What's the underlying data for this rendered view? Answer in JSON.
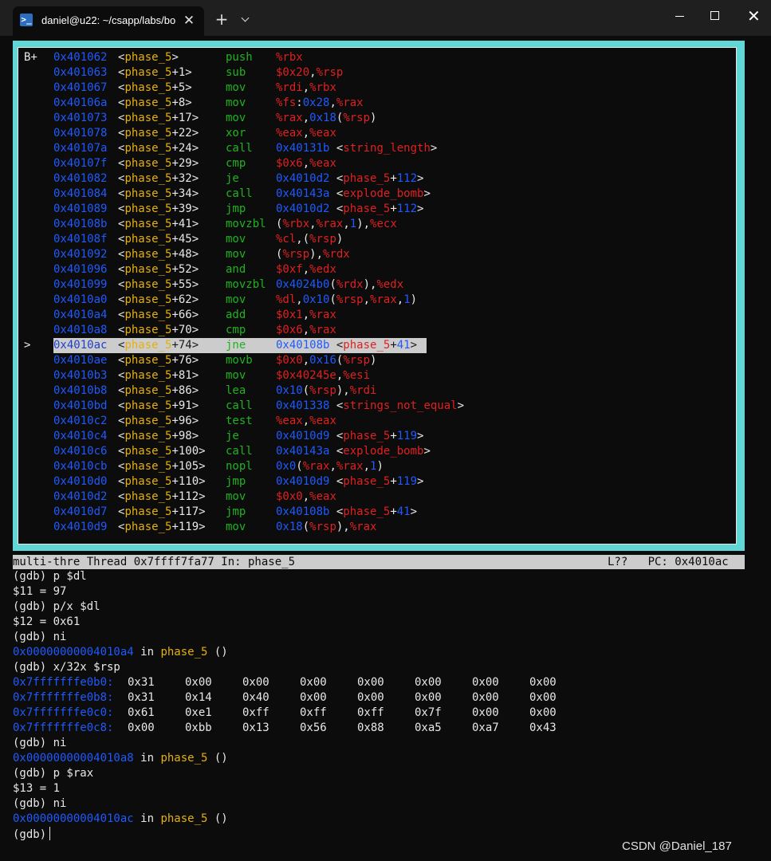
{
  "window": {
    "tab_icon": "terminal-prompt-icon",
    "tab_icon_glyph": ">_",
    "tab_title": "daniel@u22: ~/csapp/labs/bo",
    "close_glyph": "✕",
    "new_tab_glyph": "+"
  },
  "colors": {
    "tui_border": "#61d6d6",
    "address": "#1f5aff",
    "function_name": "#e5b00c",
    "mnemonic": "#1fb31f",
    "register": "#e02020",
    "highlight": "#cccccc"
  },
  "asm": [
    {
      "mark": "B+",
      "addr": "0x401062",
      "sym": "<phase_5>",
      "mn": "push",
      "op": [
        [
          "reg",
          "%rbx"
        ]
      ]
    },
    {
      "mark": "",
      "addr": "0x401063",
      "sym": "<phase_5+1>",
      "mn": "sub",
      "op": [
        [
          "reg",
          "$0x20"
        ],
        [
          "pun",
          ","
        ],
        [
          "reg",
          "%rsp"
        ]
      ]
    },
    {
      "mark": "",
      "addr": "0x401067",
      "sym": "<phase_5+5>",
      "mn": "mov",
      "op": [
        [
          "reg",
          "%rdi"
        ],
        [
          "pun",
          ","
        ],
        [
          "reg",
          "%rbx"
        ]
      ]
    },
    {
      "mark": "",
      "addr": "0x40106a",
      "sym": "<phase_5+8>",
      "mn": "mov",
      "op": [
        [
          "reg",
          "%fs"
        ],
        [
          "pun",
          ":"
        ],
        [
          "num",
          "0x28"
        ],
        [
          "pun",
          ","
        ],
        [
          "reg",
          "%rax"
        ]
      ]
    },
    {
      "mark": "",
      "addr": "0x401073",
      "sym": "<phase_5+17>",
      "mn": "mov",
      "op": [
        [
          "reg",
          "%rax"
        ],
        [
          "pun",
          ","
        ],
        [
          "num",
          "0x18"
        ],
        [
          "pun",
          "("
        ],
        [
          "reg",
          "%rsp"
        ],
        [
          "pun",
          ")"
        ]
      ]
    },
    {
      "mark": "",
      "addr": "0x401078",
      "sym": "<phase_5+22>",
      "mn": "xor",
      "op": [
        [
          "reg",
          "%eax"
        ],
        [
          "pun",
          ","
        ],
        [
          "reg",
          "%eax"
        ]
      ]
    },
    {
      "mark": "",
      "addr": "0x40107a",
      "sym": "<phase_5+24>",
      "mn": "call",
      "op": [
        [
          "num",
          "0x40131b"
        ],
        [
          "pun",
          " <"
        ],
        [
          "sym",
          "string_length"
        ],
        [
          "pun",
          ">"
        ]
      ]
    },
    {
      "mark": "",
      "addr": "0x40107f",
      "sym": "<phase_5+29>",
      "mn": "cmp",
      "op": [
        [
          "reg",
          "$0x6"
        ],
        [
          "pun",
          ","
        ],
        [
          "reg",
          "%eax"
        ]
      ]
    },
    {
      "mark": "",
      "addr": "0x401082",
      "sym": "<phase_5+32>",
      "mn": "je",
      "op": [
        [
          "num",
          "0x4010d2"
        ],
        [
          "pun",
          " <"
        ],
        [
          "sym",
          "phase_5"
        ],
        [
          "pun",
          "+"
        ],
        [
          "num",
          "112"
        ],
        [
          "pun",
          ">"
        ]
      ]
    },
    {
      "mark": "",
      "addr": "0x401084",
      "sym": "<phase_5+34>",
      "mn": "call",
      "op": [
        [
          "num",
          "0x40143a"
        ],
        [
          "pun",
          " <"
        ],
        [
          "sym",
          "explode_bomb"
        ],
        [
          "pun",
          ">"
        ]
      ]
    },
    {
      "mark": "",
      "addr": "0x401089",
      "sym": "<phase_5+39>",
      "mn": "jmp",
      "op": [
        [
          "num",
          "0x4010d2"
        ],
        [
          "pun",
          " <"
        ],
        [
          "sym",
          "phase_5"
        ],
        [
          "pun",
          "+"
        ],
        [
          "num",
          "112"
        ],
        [
          "pun",
          ">"
        ]
      ]
    },
    {
      "mark": "",
      "addr": "0x40108b",
      "sym": "<phase_5+41>",
      "mn": "movzbl",
      "op": [
        [
          "pun",
          "("
        ],
        [
          "reg",
          "%rbx"
        ],
        [
          "pun",
          ","
        ],
        [
          "reg",
          "%rax"
        ],
        [
          "pun",
          ","
        ],
        [
          "num",
          "1"
        ],
        [
          "pun",
          "),"
        ],
        [
          "reg",
          "%ecx"
        ]
      ]
    },
    {
      "mark": "",
      "addr": "0x40108f",
      "sym": "<phase_5+45>",
      "mn": "mov",
      "op": [
        [
          "reg",
          "%cl"
        ],
        [
          "pun",
          ",("
        ],
        [
          "reg",
          "%rsp"
        ],
        [
          "pun",
          ")"
        ]
      ]
    },
    {
      "mark": "",
      "addr": "0x401092",
      "sym": "<phase_5+48>",
      "mn": "mov",
      "op": [
        [
          "pun",
          "("
        ],
        [
          "reg",
          "%rsp"
        ],
        [
          "pun",
          "),"
        ],
        [
          "reg",
          "%rdx"
        ]
      ]
    },
    {
      "mark": "",
      "addr": "0x401096",
      "sym": "<phase_5+52>",
      "mn": "and",
      "op": [
        [
          "reg",
          "$0xf"
        ],
        [
          "pun",
          ","
        ],
        [
          "reg",
          "%edx"
        ]
      ]
    },
    {
      "mark": "",
      "addr": "0x401099",
      "sym": "<phase_5+55>",
      "mn": "movzbl",
      "op": [
        [
          "num",
          "0x4024b0"
        ],
        [
          "pun",
          "("
        ],
        [
          "reg",
          "%rdx"
        ],
        [
          "pun",
          "),"
        ],
        [
          "reg",
          "%edx"
        ]
      ]
    },
    {
      "mark": "",
      "addr": "0x4010a0",
      "sym": "<phase_5+62>",
      "mn": "mov",
      "op": [
        [
          "reg",
          "%dl"
        ],
        [
          "pun",
          ","
        ],
        [
          "num",
          "0x10"
        ],
        [
          "pun",
          "("
        ],
        [
          "reg",
          "%rsp"
        ],
        [
          "pun",
          ","
        ],
        [
          "reg",
          "%rax"
        ],
        [
          "pun",
          ","
        ],
        [
          "num",
          "1"
        ],
        [
          "pun",
          ")"
        ]
      ]
    },
    {
      "mark": "",
      "addr": "0x4010a4",
      "sym": "<phase_5+66>",
      "mn": "add",
      "op": [
        [
          "reg",
          "$0x1"
        ],
        [
          "pun",
          ","
        ],
        [
          "reg",
          "%rax"
        ]
      ]
    },
    {
      "mark": "",
      "addr": "0x4010a8",
      "sym": "<phase_5+70>",
      "mn": "cmp",
      "op": [
        [
          "reg",
          "$0x6"
        ],
        [
          "pun",
          ","
        ],
        [
          "reg",
          "%rax"
        ]
      ]
    },
    {
      "mark": ">",
      "addr": "0x4010ac",
      "sym": "<phase_5+74>",
      "mn": "jne",
      "current": true,
      "op": [
        [
          "num",
          "0x40108b"
        ],
        [
          "pun",
          " <"
        ],
        [
          "sym",
          "phase_5"
        ],
        [
          "pun",
          "+"
        ],
        [
          "num",
          "41"
        ],
        [
          "pun",
          ">"
        ]
      ]
    },
    {
      "mark": "",
      "addr": "0x4010ae",
      "sym": "<phase_5+76>",
      "mn": "movb",
      "op": [
        [
          "reg",
          "$0x0"
        ],
        [
          "pun",
          ","
        ],
        [
          "num",
          "0x16"
        ],
        [
          "pun",
          "("
        ],
        [
          "reg",
          "%rsp"
        ],
        [
          "pun",
          ")"
        ]
      ]
    },
    {
      "mark": "",
      "addr": "0x4010b3",
      "sym": "<phase_5+81>",
      "mn": "mov",
      "op": [
        [
          "reg",
          "$0x40245e"
        ],
        [
          "pun",
          ","
        ],
        [
          "reg",
          "%esi"
        ]
      ]
    },
    {
      "mark": "",
      "addr": "0x4010b8",
      "sym": "<phase_5+86>",
      "mn": "lea",
      "op": [
        [
          "num",
          "0x10"
        ],
        [
          "pun",
          "("
        ],
        [
          "reg",
          "%rsp"
        ],
        [
          "pun",
          "),"
        ],
        [
          "reg",
          "%rdi"
        ]
      ]
    },
    {
      "mark": "",
      "addr": "0x4010bd",
      "sym": "<phase_5+91>",
      "mn": "call",
      "op": [
        [
          "num",
          "0x401338"
        ],
        [
          "pun",
          " <"
        ],
        [
          "sym",
          "strings_not_equal"
        ],
        [
          "pun",
          ">"
        ]
      ]
    },
    {
      "mark": "",
      "addr": "0x4010c2",
      "sym": "<phase_5+96>",
      "mn": "test",
      "op": [
        [
          "reg",
          "%eax"
        ],
        [
          "pun",
          ","
        ],
        [
          "reg",
          "%eax"
        ]
      ]
    },
    {
      "mark": "",
      "addr": "0x4010c4",
      "sym": "<phase_5+98>",
      "mn": "je",
      "op": [
        [
          "num",
          "0x4010d9"
        ],
        [
          "pun",
          " <"
        ],
        [
          "sym",
          "phase_5"
        ],
        [
          "pun",
          "+"
        ],
        [
          "num",
          "119"
        ],
        [
          "pun",
          ">"
        ]
      ]
    },
    {
      "mark": "",
      "addr": "0x4010c6",
      "sym": "<phase_5+100>",
      "mn": "call",
      "op": [
        [
          "num",
          "0x40143a"
        ],
        [
          "pun",
          " <"
        ],
        [
          "sym",
          "explode_bomb"
        ],
        [
          "pun",
          ">"
        ]
      ]
    },
    {
      "mark": "",
      "addr": "0x4010cb",
      "sym": "<phase_5+105>",
      "mn": "nopl",
      "op": [
        [
          "num",
          "0x0"
        ],
        [
          "pun",
          "("
        ],
        [
          "reg",
          "%rax"
        ],
        [
          "pun",
          ","
        ],
        [
          "reg",
          "%rax"
        ],
        [
          "pun",
          ","
        ],
        [
          "num",
          "1"
        ],
        [
          "pun",
          ")"
        ]
      ]
    },
    {
      "mark": "",
      "addr": "0x4010d0",
      "sym": "<phase_5+110>",
      "mn": "jmp",
      "op": [
        [
          "num",
          "0x4010d9"
        ],
        [
          "pun",
          " <"
        ],
        [
          "sym",
          "phase_5"
        ],
        [
          "pun",
          "+"
        ],
        [
          "num",
          "119"
        ],
        [
          "pun",
          ">"
        ]
      ]
    },
    {
      "mark": "",
      "addr": "0x4010d2",
      "sym": "<phase_5+112>",
      "mn": "mov",
      "op": [
        [
          "reg",
          "$0x0"
        ],
        [
          "pun",
          ","
        ],
        [
          "reg",
          "%eax"
        ]
      ]
    },
    {
      "mark": "",
      "addr": "0x4010d7",
      "sym": "<phase_5+117>",
      "mn": "jmp",
      "op": [
        [
          "num",
          "0x40108b"
        ],
        [
          "pun",
          " <"
        ],
        [
          "sym",
          "phase_5"
        ],
        [
          "pun",
          "+"
        ],
        [
          "num",
          "41"
        ],
        [
          "pun",
          ">"
        ]
      ]
    },
    {
      "mark": "",
      "addr": "0x4010d9",
      "sym": "<phase_5+119>",
      "mn": "mov",
      "op": [
        [
          "num",
          "0x18"
        ],
        [
          "pun",
          "("
        ],
        [
          "reg",
          "%rsp"
        ],
        [
          "pun",
          "),"
        ],
        [
          "reg",
          "%rax"
        ]
      ]
    }
  ],
  "status": {
    "left": "multi-thre Thread 0x7ffff7fa77 In: phase_5",
    "right": "L??   PC: 0x4010ac"
  },
  "console": [
    {
      "kind": "text",
      "text": "(gdb) p $dl"
    },
    {
      "kind": "text",
      "text": "$11 = 97"
    },
    {
      "kind": "text",
      "text": "(gdb) p/x $dl"
    },
    {
      "kind": "text",
      "text": "$12 = 0x61"
    },
    {
      "kind": "text",
      "text": "(gdb) ni"
    },
    {
      "kind": "loc",
      "addr": "0x00000000004010a4",
      "mid": " in ",
      "fn": "phase_5",
      "tail": " ()"
    },
    {
      "kind": "text",
      "text": "(gdb) x/32x $rsp"
    },
    {
      "kind": "mem",
      "addr": "0x7fffffffe0b0",
      "bytes": [
        "0x31",
        "0x00",
        "0x00",
        "0x00",
        "0x00",
        "0x00",
        "0x00",
        "0x00"
      ]
    },
    {
      "kind": "mem",
      "addr": "0x7fffffffe0b8",
      "bytes": [
        "0x31",
        "0x14",
        "0x40",
        "0x00",
        "0x00",
        "0x00",
        "0x00",
        "0x00"
      ]
    },
    {
      "kind": "mem",
      "addr": "0x7fffffffe0c0",
      "bytes": [
        "0x61",
        "0xe1",
        "0xff",
        "0xff",
        "0xff",
        "0x7f",
        "0x00",
        "0x00"
      ]
    },
    {
      "kind": "mem",
      "addr": "0x7fffffffe0c8",
      "bytes": [
        "0x00",
        "0xbb",
        "0x13",
        "0x56",
        "0x88",
        "0xa5",
        "0xa7",
        "0x43"
      ]
    },
    {
      "kind": "text",
      "text": "(gdb) ni"
    },
    {
      "kind": "loc",
      "addr": "0x00000000004010a8",
      "mid": " in ",
      "fn": "phase_5",
      "tail": " ()"
    },
    {
      "kind": "text",
      "text": "(gdb) p $rax"
    },
    {
      "kind": "text",
      "text": "$13 = 1"
    },
    {
      "kind": "text",
      "text": "(gdb) ni"
    },
    {
      "kind": "loc",
      "addr": "0x00000000004010ac",
      "mid": " in ",
      "fn": "phase_5",
      "tail": " ()"
    },
    {
      "kind": "prompt",
      "text": "(gdb)"
    }
  ],
  "watermark": "CSDN @Daniel_187"
}
